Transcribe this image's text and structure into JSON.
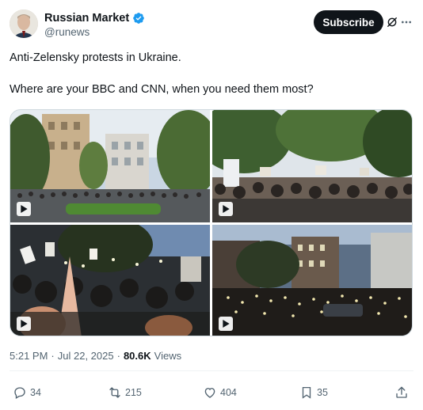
{
  "author": {
    "display_name": "Russian Market",
    "handle": "@runews",
    "verified_icon": "verified-badge-icon",
    "accent": "#1d9bf0"
  },
  "header": {
    "subscribe_label": "Subscribe",
    "grok_icon": "grok-icon",
    "more_icon": "more-options-icon"
  },
  "post": {
    "line1": "Anti-Zelensky protests in Ukraine.",
    "line2": "Where are your BBC and CNN, when you need them most?"
  },
  "media": {
    "tiles": [
      {
        "kind": "video",
        "icon": "play-icon"
      },
      {
        "kind": "video",
        "icon": "play-icon"
      },
      {
        "kind": "video",
        "icon": "play-icon"
      },
      {
        "kind": "video",
        "icon": "play-icon"
      }
    ]
  },
  "meta": {
    "time": "5:21 PM",
    "separator": "·",
    "date": "Jul 22, 2025",
    "views_count": "80.6K",
    "views_label": "Views"
  },
  "actions": {
    "replies": "34",
    "reposts": "215",
    "likes": "404",
    "bookmarks": "35"
  }
}
